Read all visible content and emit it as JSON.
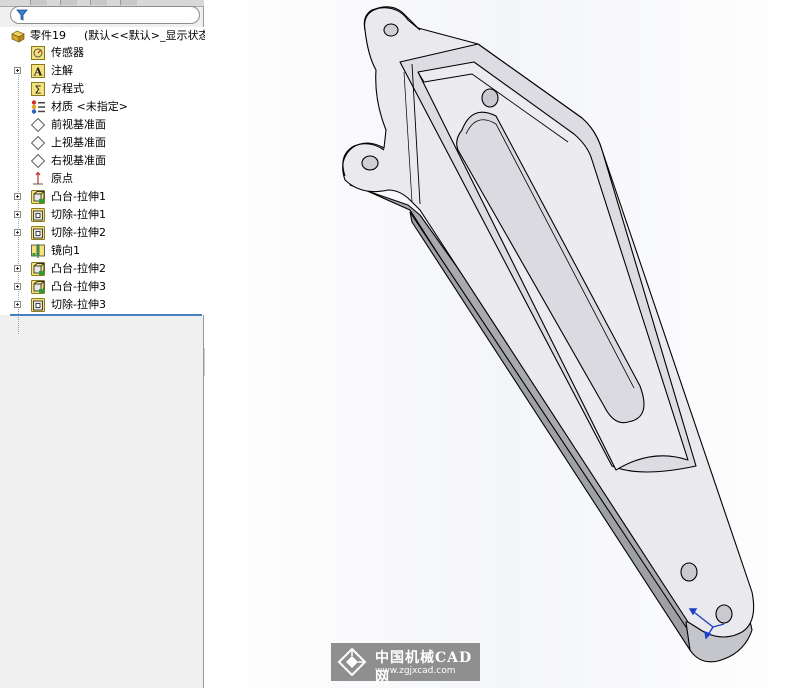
{
  "feature_tree": {
    "root": {
      "name": "零件19",
      "config": "(默认<<默认>_显示状态",
      "icon": "part-icon"
    },
    "items": [
      {
        "label": "传感器",
        "icon": "sensor-icon",
        "expandable": false
      },
      {
        "label": "注解",
        "icon": "annotation-icon",
        "expandable": true
      },
      {
        "label": "方程式",
        "icon": "equation-icon",
        "expandable": false
      },
      {
        "label": "材质 <未指定>",
        "icon": "material-icon",
        "expandable": false
      },
      {
        "label": "前视基准面",
        "icon": "plane-icon",
        "expandable": false
      },
      {
        "label": "上视基准面",
        "icon": "plane-icon",
        "expandable": false
      },
      {
        "label": "右视基准面",
        "icon": "plane-icon",
        "expandable": false
      },
      {
        "label": "原点",
        "icon": "origin-icon",
        "expandable": false
      },
      {
        "label": "凸台-拉伸1",
        "icon": "boss-extrude-icon",
        "expandable": true
      },
      {
        "label": "切除-拉伸1",
        "icon": "cut-extrude-icon",
        "expandable": true
      },
      {
        "label": "切除-拉伸2",
        "icon": "cut-extrude-icon",
        "expandable": true
      },
      {
        "label": "镜向1",
        "icon": "mirror-icon",
        "expandable": false
      },
      {
        "label": "凸台-拉伸2",
        "icon": "boss-extrude-icon",
        "expandable": true
      },
      {
        "label": "凸台-拉伸3",
        "icon": "boss-extrude-icon",
        "expandable": true
      },
      {
        "label": "切除-拉伸3",
        "icon": "cut-extrude-icon",
        "expandable": true
      }
    ]
  },
  "watermark": {
    "cn": "中国机械CAD网",
    "url": "www.zgjxcad.com"
  },
  "colors": {
    "accent": "#4a7fc0",
    "model_face": "#e8e8ec",
    "model_side": "#b8b8c0",
    "model_edge": "#000000"
  }
}
